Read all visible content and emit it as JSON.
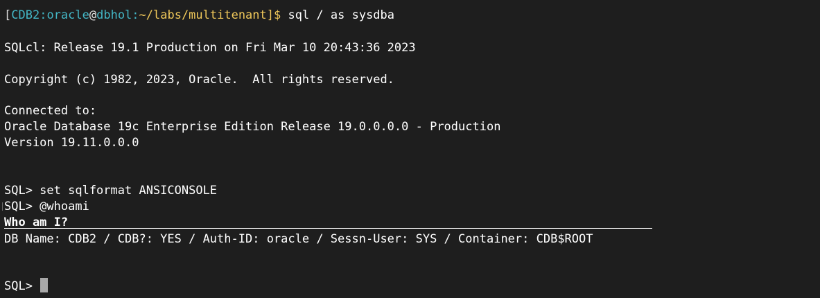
{
  "prompt_line": {
    "open_bracket": "[",
    "cdb": "CDB2:",
    "user": "oracle",
    "at": "@",
    "host": "dbhol:",
    "path": "~/labs/multitenant",
    "close": "]$ ",
    "command": "sql / as sysdba"
  },
  "output": {
    "release": "SQLcl: Release 19.1 Production on Fri Mar 10 20:43:36 2023",
    "copyright": "Copyright (c) 1982, 2023, Oracle.  All rights reserved.",
    "connected": "Connected to:",
    "database": "Oracle Database 19c Enterprise Edition Release 19.0.0.0.0 - Production",
    "version": "Version 19.11.0.0.0"
  },
  "session": {
    "cmd1": "SQL> set sqlformat ANSICONSOLE",
    "cmd2": "SQL> @whoami",
    "header": "Who am I?",
    "result": "DB Name: CDB2 / CDB?: YES / Auth-ID: oracle / Sessn-User: SYS / Container: CDB$ROOT",
    "prompt": "SQL> "
  }
}
